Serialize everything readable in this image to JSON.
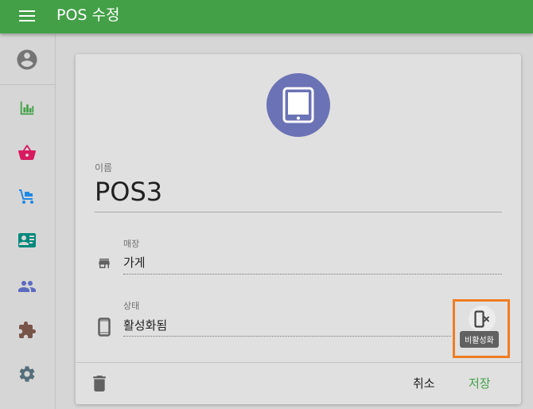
{
  "app_bar": {
    "title": "POS 수정",
    "color": "#43a047"
  },
  "sidebar": {
    "items": [
      {
        "icon": "account-circle-icon",
        "color": "#757575"
      },
      {
        "icon": "bar-chart-icon",
        "color": "#43a047"
      },
      {
        "icon": "shopping-basket-icon",
        "color": "#d81b60"
      },
      {
        "icon": "cart-dolly-icon",
        "color": "#1e88e5"
      },
      {
        "icon": "contact-card-icon",
        "color": "#00897b"
      },
      {
        "icon": "people-icon",
        "color": "#5c6bc0"
      },
      {
        "icon": "puzzle-icon",
        "color": "#795548"
      },
      {
        "icon": "gear-icon",
        "color": "#546e7a"
      }
    ]
  },
  "form": {
    "avatar_icon": "tablet-icon",
    "avatar_color": "#6b72b5",
    "name_label": "이름",
    "name_value": "POS3",
    "store_label": "매장",
    "store_value": "가게",
    "status_label": "상태",
    "status_value": "활성화됨",
    "deactivate_tooltip": "비활성화"
  },
  "actions": {
    "cancel_label": "취소",
    "save_label": "저장"
  }
}
